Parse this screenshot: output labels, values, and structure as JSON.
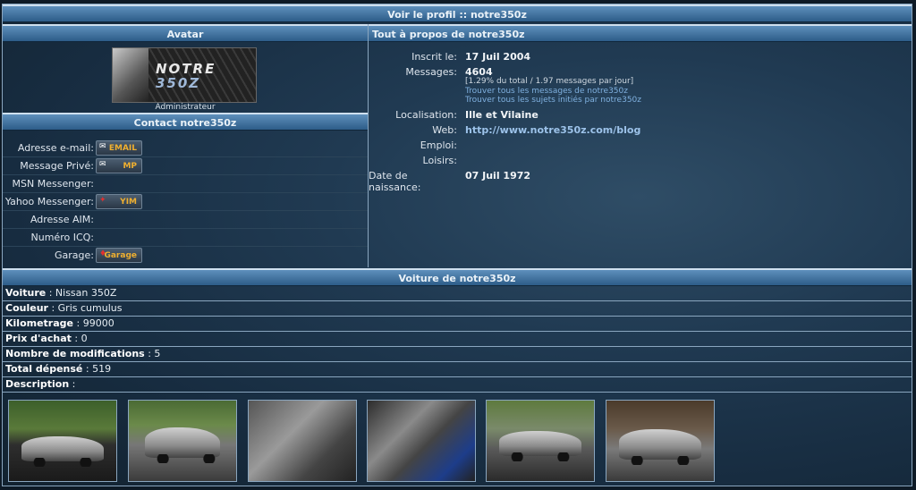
{
  "page_title": "Voir le profil :: notre350z",
  "avatar": {
    "title": "Avatar",
    "logo_line1": "NOTRE",
    "logo_line2": "350Z",
    "rank": "Administrateur"
  },
  "contact": {
    "title": "Contact notre350z",
    "rows": [
      {
        "label": "Adresse e-mail:",
        "button": "EMAIL",
        "icon": "email-icon"
      },
      {
        "label": "Message Privé:",
        "button": "MP",
        "icon": "pm-icon"
      },
      {
        "label": "MSN Messenger:",
        "button": ""
      },
      {
        "label": "Yahoo Messenger:",
        "button": "YIM",
        "icon": "yahoo-icon"
      },
      {
        "label": "Adresse AIM:",
        "button": ""
      },
      {
        "label": "Numéro ICQ:",
        "button": ""
      },
      {
        "label": "Garage:",
        "button": "Garage",
        "icon": "garage-icon"
      }
    ]
  },
  "about": {
    "title": "Tout à propos de notre350z",
    "inscrit_label": "Inscrit le:",
    "inscrit_value": "17 Juil 2004",
    "messages_label": "Messages:",
    "messages_value": "4604",
    "messages_stats": "[1.29% du total / 1.97 messages par jour]",
    "link_messages": "Trouver tous les messages de notre350z",
    "link_topics": "Trouver tous les sujets initiés par notre350z",
    "localisation_label": "Localisation:",
    "localisation_value": "Ille et Vilaine",
    "web_label": "Web:",
    "web_value": "http://www.notre350z.com/blog",
    "emploi_label": "Emploi:",
    "loisirs_label": "Loisirs:",
    "naissance_label": "Date de naissance:",
    "naissance_value": "07 Juil 1972"
  },
  "car": {
    "title": "Voiture de notre350z",
    "rows": [
      {
        "label": "Voiture",
        "value": " : Nissan 350Z"
      },
      {
        "label": "Couleur",
        "value": " : Gris cumulus"
      },
      {
        "label": "Kilometrage",
        "value": " : 99000"
      },
      {
        "label": "Prix d'achat",
        "value": " : 0"
      },
      {
        "label": "Nombre de modifications",
        "value": " : 5"
      },
      {
        "label": "Total dépensé",
        "value": " : 519"
      },
      {
        "label": "Description",
        "value": " :"
      }
    ],
    "thumbnail_count": 6
  }
}
